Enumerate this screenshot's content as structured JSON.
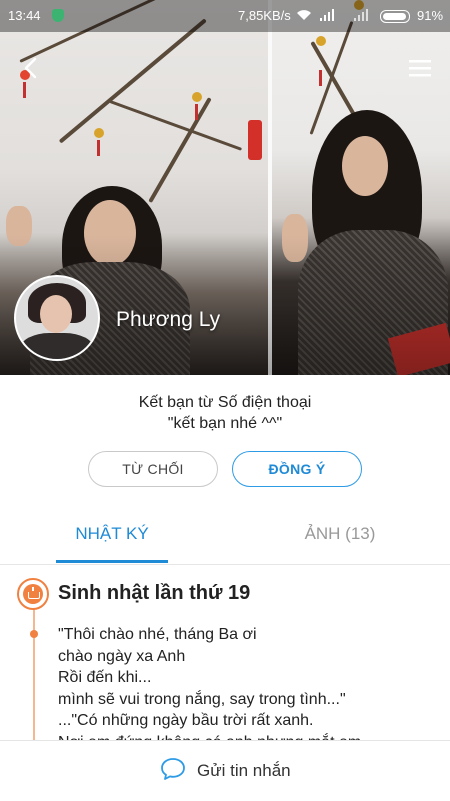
{
  "status_bar": {
    "time": "13:44",
    "network_speed": "7,85KB/s",
    "battery": "91%"
  },
  "profile": {
    "name": "Phương Ly"
  },
  "friend_request": {
    "source": "Kết bạn từ Số điện thoại",
    "message": "\"kết bạn nhé ^^\"",
    "decline_label": "TỪ CHỐI",
    "accept_label": "ĐỒNG Ý"
  },
  "tabs": [
    {
      "label": "NHẬT KÝ",
      "active": true
    },
    {
      "label": "ẢNH (13)",
      "active": false
    }
  ],
  "timeline": {
    "event_title": "Sinh nhật lần thứ 19",
    "poem_lines": [
      "\"Thôi chào nhé, tháng Ba ơi",
      "chào ngày xa Anh",
      "Rồi đến khi...",
      "mình sẽ vui trong nắng, say trong tình...\"",
      "...\"Có những ngày bầu trời rất xanh.",
      "Nơi em đứng không có anh nhưng mắt em"
    ]
  },
  "bottom_bar": {
    "send_label": "Gửi tin nhắn"
  },
  "icons": {
    "back": "back-arrow-icon",
    "menu": "menu-icon",
    "event": "birthday-cake-icon",
    "chat": "chat-bubble-icon"
  },
  "colors": {
    "accent_blue": "#1f8ad6",
    "event_orange": "#f08140"
  }
}
